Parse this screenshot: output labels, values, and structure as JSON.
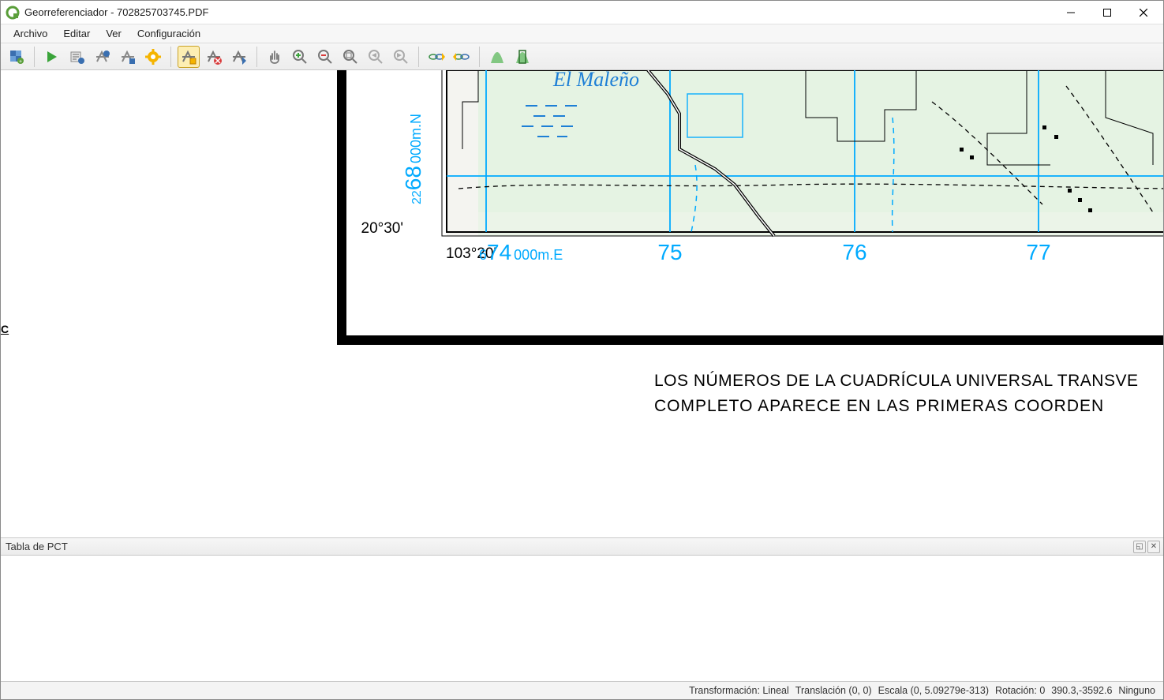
{
  "window": {
    "title": "Georreferenciador - 702825703745.PDF"
  },
  "menu": {
    "archivo": "Archivo",
    "editar": "Editar",
    "ver": "Ver",
    "configuracion": "Configuración"
  },
  "panel": {
    "title": "Tabla de PCT"
  },
  "status": {
    "transform_label": "Transformación:",
    "transform_value": "Lineal",
    "translation_label": "Translación",
    "translation_value": "(0, 0)",
    "scale_label": "Escala",
    "scale_value": "(0, 5.09279e-313)",
    "rotation_label": "Rotación:",
    "rotation_value": "0",
    "coords": "390.3,-3592.6",
    "units": "Ninguno"
  },
  "map": {
    "place_label": "El Maleño",
    "lat_label": "20°30'",
    "lon_label": "103°20'",
    "northing_small1": "2",
    "northing_small2": "2",
    "northing_big": "68",
    "northing_suffix": "000m.N",
    "easting_small": "6",
    "easting_big": "74",
    "easting_suffix": "000m.E",
    "grid_75": "75",
    "grid_76": "76",
    "grid_77": "77",
    "note_line1": "LOS NÚMEROS DE LA CUADRÍCULA UNIVERSAL TRANSVE",
    "note_line2": "COMPLETO  APARECE  EN  LAS PRIMERAS  COORDEN",
    "left_cut": "C"
  }
}
